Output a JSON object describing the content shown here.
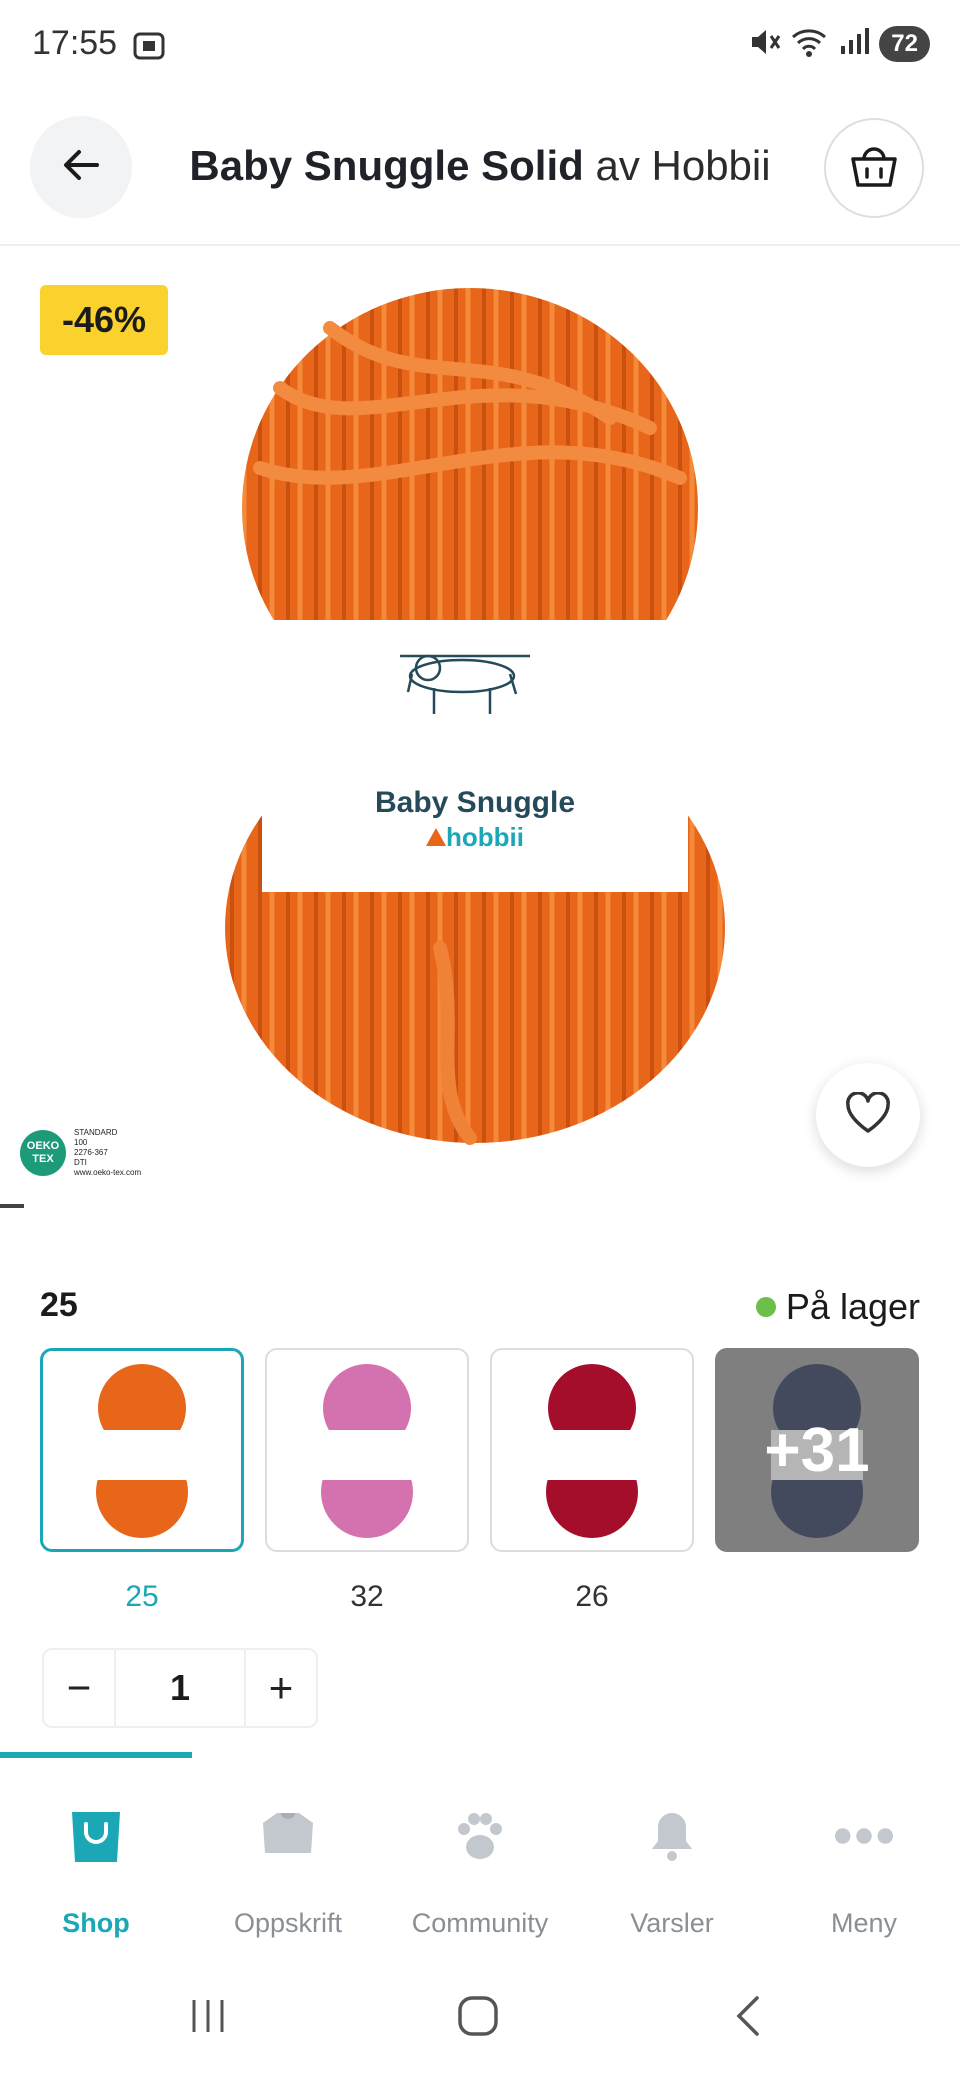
{
  "status_bar": {
    "time": "17:55",
    "battery": "72"
  },
  "header": {
    "title_main": "Baby Snuggle Solid",
    "title_sep": " av ",
    "title_brand": "Hobbii"
  },
  "product": {
    "discount": "-46%",
    "label_name": "Baby Snuggle",
    "label_brand": "hobbii",
    "certification_line1": "STANDARD",
    "certification_line2": "100",
    "certification_code": "2276-367",
    "certification_lab": "DTI",
    "certification_site": "www.oeko-tex.com",
    "oeko_text": "OEKO TEX",
    "yarn_color": "#e8661a"
  },
  "selection": {
    "selected_color": "25",
    "stock_status": "På lager",
    "swatches": [
      {
        "label": "25",
        "color": "#e8661a"
      },
      {
        "label": "32",
        "color": "#d472b0"
      },
      {
        "label": "26",
        "color": "#a50e2a"
      }
    ],
    "more": {
      "label": "+31",
      "color": "#2b3450"
    }
  },
  "quantity": {
    "minus": "−",
    "value": "1",
    "plus": "+"
  },
  "nav": {
    "items": [
      {
        "label": "Shop",
        "icon": "shop-bag-icon"
      },
      {
        "label": "Oppskrift",
        "icon": "sweater-icon"
      },
      {
        "label": "Community",
        "icon": "paw-icon"
      },
      {
        "label": "Varsler",
        "icon": "bell-icon"
      },
      {
        "label": "Meny",
        "icon": "more-dots-icon"
      }
    ]
  },
  "colors": {
    "accent": "#1ba7b5",
    "badge": "#fbd12e",
    "stock_dot": "#6cc04a"
  }
}
